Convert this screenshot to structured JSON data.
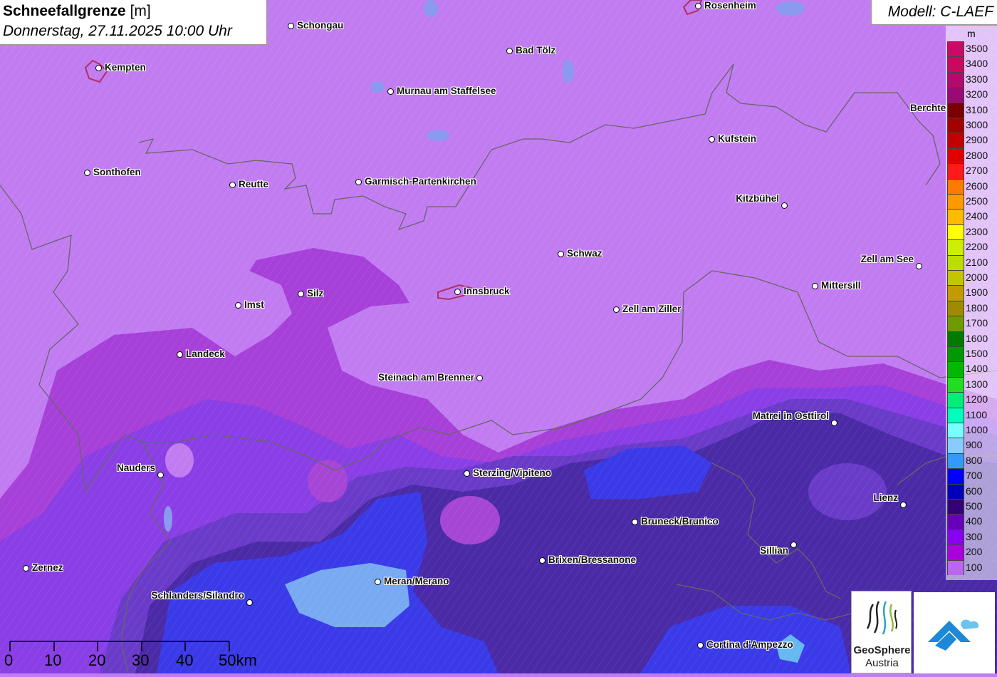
{
  "header": {
    "title_bold": "Schneefallgrenze",
    "title_unit": " [m]",
    "subtitle": "Donnerstag, 27.11.2025 10:00 Uhr"
  },
  "model": {
    "label": "Modell: C-LAEF"
  },
  "legend": {
    "unit": "m",
    "items": [
      {
        "value": "3500",
        "color": "#cc0a66"
      },
      {
        "value": "3400",
        "color": "#c80a5f"
      },
      {
        "value": "3300",
        "color": "#b30a6e"
      },
      {
        "value": "3200",
        "color": "#990a77"
      },
      {
        "value": "3100",
        "color": "#7a0000"
      },
      {
        "value": "3000",
        "color": "#a30000"
      },
      {
        "value": "2900",
        "color": "#c20000"
      },
      {
        "value": "2800",
        "color": "#e00000"
      },
      {
        "value": "2700",
        "color": "#ff1a1a"
      },
      {
        "value": "2600",
        "color": "#ff7a00"
      },
      {
        "value": "2500",
        "color": "#ff9900"
      },
      {
        "value": "2400",
        "color": "#ffbb00"
      },
      {
        "value": "2300",
        "color": "#ffff00"
      },
      {
        "value": "2200",
        "color": "#ccee00"
      },
      {
        "value": "2100",
        "color": "#bbdd00"
      },
      {
        "value": "2000",
        "color": "#c4c400"
      },
      {
        "value": "1900",
        "color": "#c29b00"
      },
      {
        "value": "1800",
        "color": "#a08a00"
      },
      {
        "value": "1700",
        "color": "#6e9a00"
      },
      {
        "value": "1600",
        "color": "#007a00"
      },
      {
        "value": "1500",
        "color": "#009900"
      },
      {
        "value": "1400",
        "color": "#00b800"
      },
      {
        "value": "1300",
        "color": "#22dd22"
      },
      {
        "value": "1200",
        "color": "#00ee77"
      },
      {
        "value": "1100",
        "color": "#00ffbb"
      },
      {
        "value": "1000",
        "color": "#77ffff"
      },
      {
        "value": "900",
        "color": "#88ccff"
      },
      {
        "value": "800",
        "color": "#3399ff"
      },
      {
        "value": "700",
        "color": "#0000ff"
      },
      {
        "value": "600",
        "color": "#0000bb"
      },
      {
        "value": "500",
        "color": "#330077"
      },
      {
        "value": "400",
        "color": "#6600bb"
      },
      {
        "value": "300",
        "color": "#8800ee"
      },
      {
        "value": "200",
        "color": "#aa00dd"
      },
      {
        "value": "100",
        "color": "#bb66ee"
      }
    ]
  },
  "cities": [
    {
      "name": "Schongau"
    },
    {
      "name": "Rosenheim"
    },
    {
      "name": "Kempten"
    },
    {
      "name": "Bad Tölz"
    },
    {
      "name": "Murnau am Staffelsee"
    },
    {
      "name": "Berchte"
    },
    {
      "name": "Kufstein"
    },
    {
      "name": "Sonthofen"
    },
    {
      "name": "Reutte"
    },
    {
      "name": "Garmisch-Partenkirchen"
    },
    {
      "name": "Kitzbühel"
    },
    {
      "name": "Schwaz"
    },
    {
      "name": "Zell am See"
    },
    {
      "name": "Mittersill"
    },
    {
      "name": "Innsbruck"
    },
    {
      "name": "Silz"
    },
    {
      "name": "Imst"
    },
    {
      "name": "Zell am Ziller"
    },
    {
      "name": "Landeck"
    },
    {
      "name": "Steinach am Brenner"
    },
    {
      "name": "Matrei in Osttirol"
    },
    {
      "name": "Nauders"
    },
    {
      "name": "Sterzing/Vipiteno"
    },
    {
      "name": "Lienz"
    },
    {
      "name": "Bruneck/Brunico"
    },
    {
      "name": "Sillian"
    },
    {
      "name": "Brixen/Bressanone"
    },
    {
      "name": "Zernez"
    },
    {
      "name": "Meran/Merano"
    },
    {
      "name": "Schlanders/Silandro"
    },
    {
      "name": "Cortina d'Ampezzo"
    }
  ],
  "scale": {
    "labels": [
      "0",
      "10",
      "20",
      "30",
      "40",
      "50km"
    ]
  },
  "logos": {
    "geosphere_line1": "GeoSphere",
    "geosphere_line2": "Austria"
  }
}
